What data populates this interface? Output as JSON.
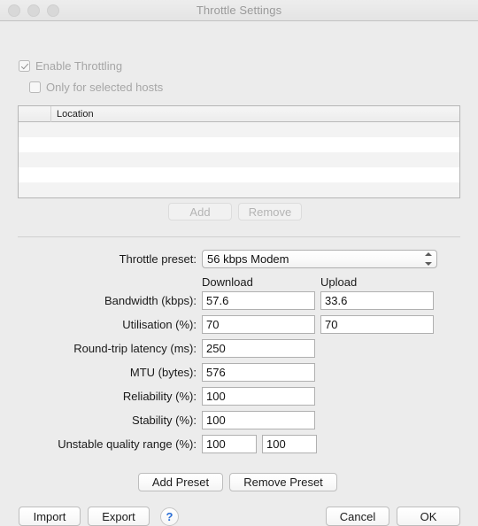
{
  "window": {
    "title": "Throttle Settings",
    "traffic_lights": [
      "close-button",
      "minimize-button",
      "zoom-button"
    ]
  },
  "options": {
    "enable_throttling": {
      "label": "Enable Throttling",
      "checked": true,
      "disabled": true
    },
    "only_selected_hosts": {
      "label": "Only for selected hosts",
      "checked": false,
      "disabled": true
    }
  },
  "hosts_table": {
    "columns": [
      "",
      "Location"
    ],
    "rows": [],
    "empty_row_count": 5
  },
  "host_buttons": {
    "add": "Add",
    "remove": "Remove"
  },
  "preset": {
    "label": "Throttle preset:",
    "value": "56 kbps Modem"
  },
  "columns": {
    "download": "Download",
    "upload": "Upload"
  },
  "fields": [
    {
      "label": "Bandwidth (kbps):",
      "download": "57.6",
      "upload": "33.6"
    },
    {
      "label": "Utilisation (%):",
      "download": "70",
      "upload": "70"
    },
    {
      "label": "Round-trip latency (ms):",
      "value": "250"
    },
    {
      "label": "MTU (bytes):",
      "value": "576"
    },
    {
      "label": "Reliability (%):",
      "value": "100"
    },
    {
      "label": "Stability (%):",
      "value": "100"
    },
    {
      "label": "Unstable quality range (%):",
      "min": "100",
      "max": "100"
    }
  ],
  "preset_buttons": {
    "add": "Add Preset",
    "remove": "Remove Preset"
  },
  "footer": {
    "import": "Import",
    "export": "Export",
    "help": "?",
    "cancel": "Cancel",
    "ok": "OK"
  },
  "colors": {
    "window_bg": "#ececec",
    "help_blue": "#2b6fd6",
    "disabled_text": "#a6a6a6"
  }
}
